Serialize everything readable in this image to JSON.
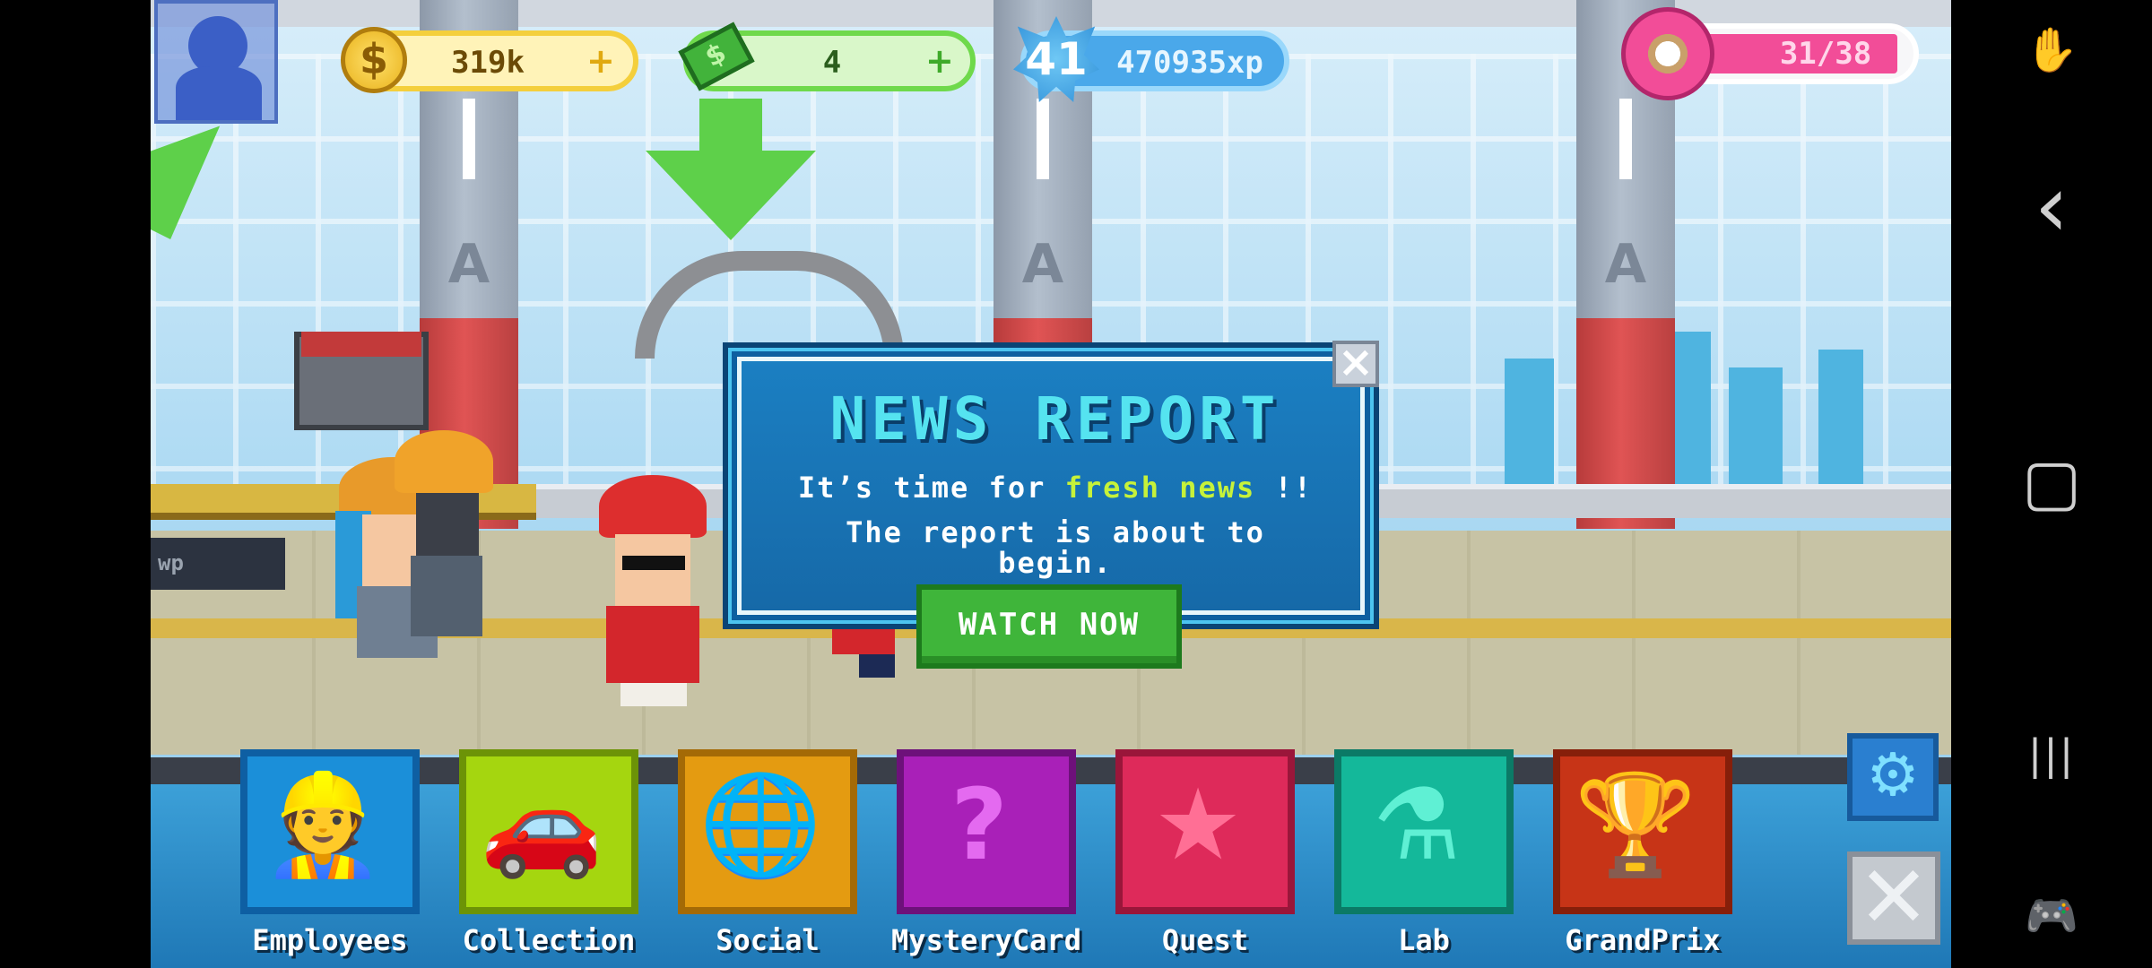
{
  "hud": {
    "coins": "319k",
    "cash": "4",
    "level": "41",
    "xp": "470935xp",
    "donuts": "31/38",
    "plus": "+"
  },
  "modal": {
    "title": "NEWS REPORT",
    "line1_pre": "It’s time for",
    "line1_highlight": "fresh news",
    "line1_post": "!!",
    "line2": "The report is about to",
    "line3": "begin.",
    "watch_button": "WATCH NOW",
    "close": "×"
  },
  "menu": [
    {
      "label": "Employees",
      "color": "#1b8fd9",
      "border": "#0e5fa3",
      "glyph": "👷",
      "glyph_color": "#5fd0ff"
    },
    {
      "label": "Collection",
      "color": "#a5d60f",
      "border": "#6c9307",
      "glyph": "🚗",
      "glyph_color": "#e6ff55"
    },
    {
      "label": "Social",
      "color": "#e49b11",
      "border": "#a46a06",
      "glyph": "🌐",
      "glyph_color": "#ffc94a"
    },
    {
      "label": "MysteryCard",
      "color": "#a920b8",
      "border": "#6d117a",
      "glyph": "?",
      "glyph_color": "#e46af0"
    },
    {
      "label": "Quest",
      "color": "#de2a5a",
      "border": "#9a163a",
      "glyph": "★",
      "glyph_color": "#ff6f95"
    },
    {
      "label": "Lab",
      "color": "#14b89a",
      "border": "#0b7a66",
      "glyph": "⚗",
      "glyph_color": "#5ff0d4"
    },
    {
      "label": "GrandPrix",
      "color": "#c73417",
      "border": "#861f0a",
      "glyph": "🏆",
      "glyph_color": "#ff8a3a"
    }
  ],
  "controls": {
    "settings": "⚙",
    "close_game": "✕"
  },
  "sign": "wp",
  "nav": {
    "assist": "✋",
    "back": "‹",
    "home": "▢",
    "recents": "|||",
    "gamepad": "🎮"
  },
  "pillar_letter": "A"
}
